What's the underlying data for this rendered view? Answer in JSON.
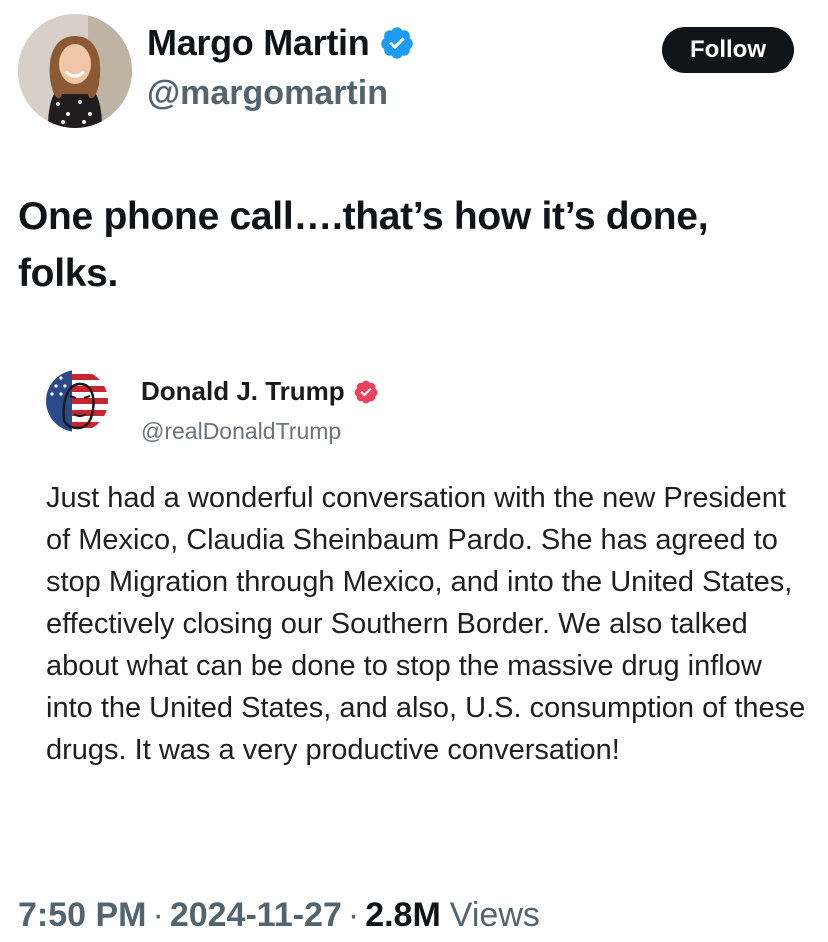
{
  "author": {
    "display_name": "Margo Martin",
    "handle": "@margomartin",
    "avatar_icon": "profile-photo",
    "verified_icon": "verified-badge-icon",
    "verified_color": "#1d9bf0"
  },
  "follow_button": {
    "label": "Follow",
    "background": "#0f1419",
    "text_color": "#ffffff"
  },
  "tweet": {
    "text": "One phone call….that’s how it’s done, folks."
  },
  "embedded_post": {
    "display_name": "Donald J. Trump",
    "handle": "@realDonaldTrump",
    "avatar_icon": "flag-portrait-avatar",
    "verified_icon": "verified-badge-icon",
    "verified_color": "#e8435a",
    "body": "Just had a wonderful conversation with the new President of Mexico, Claudia Sheinbaum Pardo. She has agreed to stop Migration through Mexico, and into the United States, effectively closing our Southern Border. We also talked about what can be done to stop the massive drug inflow into the United States, and also, U.S. consumption of these drugs. It was a very productive conversation!"
  },
  "meta": {
    "time": "7:50 PM",
    "date": "2024-11-27",
    "separator": "·",
    "views_count": "2.8M",
    "views_label": "Views"
  }
}
